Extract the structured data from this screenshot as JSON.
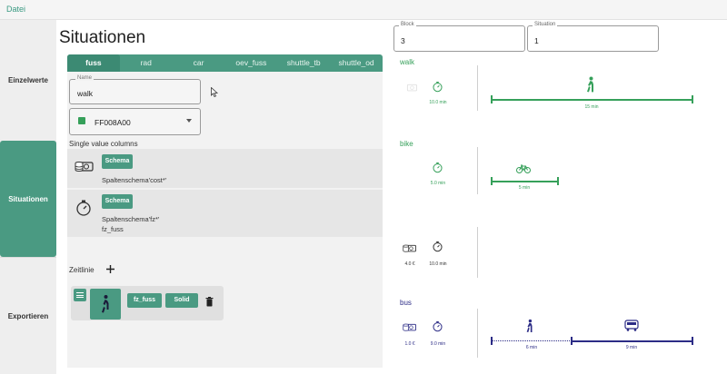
{
  "menu": {
    "file": "Datei"
  },
  "nav": {
    "items": [
      {
        "label": "Einzelwerte"
      },
      {
        "label": "Situationen"
      },
      {
        "label": "Exportieren"
      }
    ]
  },
  "main": {
    "title": "Situationen",
    "tabs": [
      "fuss",
      "rad",
      "car",
      "oev_fuss",
      "shuttle_tb",
      "shuttle_od"
    ],
    "name_field": {
      "legend": "Name",
      "value": "walk"
    },
    "color_field": {
      "value": "FF008A00",
      "swatch_color": "#36a05a"
    },
    "single_value_label": "Single value columns",
    "rows": [
      {
        "button": "Schema",
        "text": "Spaltenschema'cost*'"
      },
      {
        "button": "Schema",
        "text": "Spaltenschema'fz*'",
        "text2": "fz_fuss"
      }
    ],
    "timeline_label": "Zeitlinie",
    "timeline": {
      "column_button": "fz_fuss",
      "style_button": "Solid"
    }
  },
  "right": {
    "block": {
      "legend": "Block",
      "value": "3"
    },
    "situation": {
      "legend": "Situation",
      "value": "1"
    },
    "modes": [
      {
        "name": "walk",
        "color": "#36a05a",
        "cost": "",
        "time": "10.0 min",
        "segments": [
          "15 min"
        ]
      },
      {
        "name": "bike",
        "color": "#36a05a",
        "cost": "",
        "time": "5.0 min",
        "segments": [
          "5 min"
        ]
      },
      {
        "name": "",
        "color": "#333333",
        "cost": "4.0 €",
        "time": "10.0 min",
        "segments": []
      },
      {
        "name": "bus",
        "color": "#2c2c86",
        "cost": "1.0 €",
        "time": "9.0 min",
        "segments": [
          "6 min",
          "9 min"
        ]
      }
    ]
  },
  "colors": {
    "accent": "#4a9a82",
    "green": "#36a05a",
    "navy": "#2c2c86"
  }
}
